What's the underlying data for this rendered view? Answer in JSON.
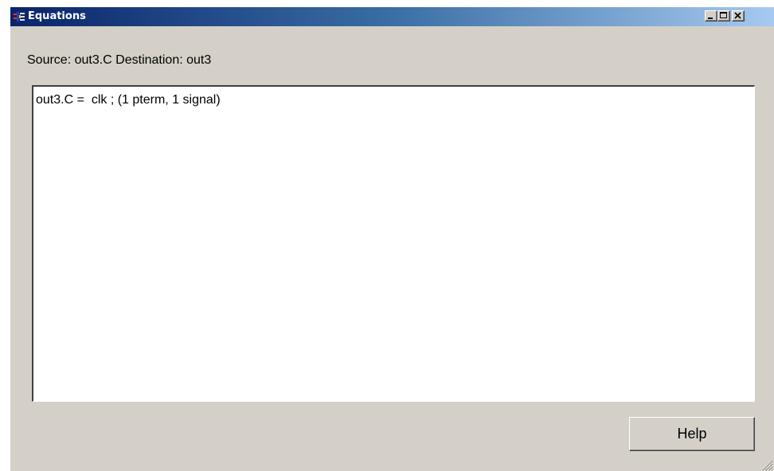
{
  "window": {
    "title": "Equations",
    "title_color": "#ffffff",
    "titlebar_gradient": [
      "#0a246a",
      "#a6caf0"
    ],
    "background": "#d4d0c8",
    "controls": [
      "minimize-icon",
      "maximize-icon",
      "close-icon"
    ]
  },
  "source_line": "Source: out3.C  Destination: out3",
  "equations": {
    "lines": [
      "out3.C =  clk ; (1 pterm, 1 signal)"
    ]
  },
  "help_button": {
    "label": "Help"
  }
}
